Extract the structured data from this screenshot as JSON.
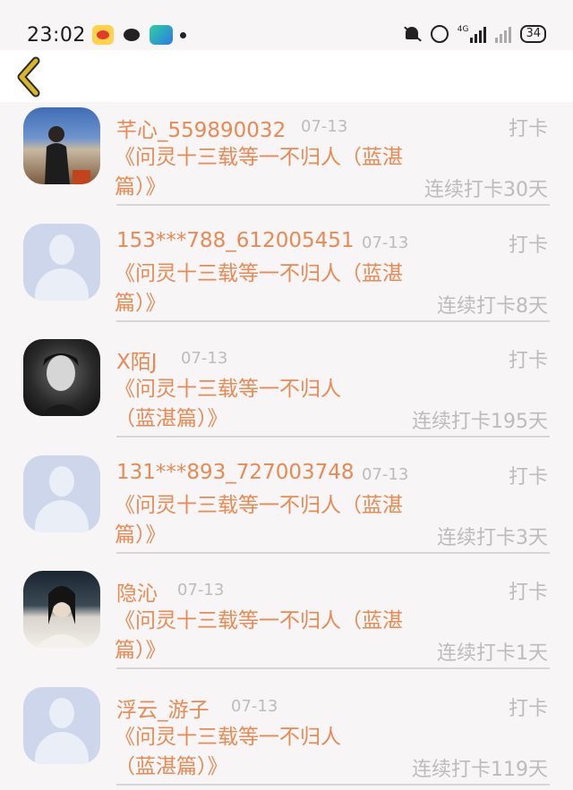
{
  "status_bar": {
    "time": "23:02",
    "network": "4G",
    "battery": "34",
    "icons": [
      "weibo-icon",
      "wechat-icon",
      "video-app-icon",
      "notification-dot",
      "mute-icon",
      "alarm-icon",
      "signal-icon",
      "signal-icon-2",
      "battery-icon"
    ]
  },
  "nav": {
    "back_icon": "chevron-left-icon",
    "back_color": "#d9b72a"
  },
  "colors": {
    "accent": "#e98a54",
    "muted": "#bcbcbc"
  },
  "checkins": [
    {
      "name": "芊心_559890032",
      "date": "07-13",
      "status": "打卡",
      "book": "《问灵十三载等一不归人（蓝湛篇）》",
      "streak": "连续打卡30天",
      "avatar": "photo1"
    },
    {
      "name": "153***788_612005451",
      "date": "07-13",
      "status": "打卡",
      "book": "《问灵十三载等一不归人（蓝湛篇）》",
      "streak": "连续打卡8天",
      "avatar": "default"
    },
    {
      "name": "X陌J",
      "date": "07-13",
      "status": "打卡",
      "book": "《问灵十三载等一不归人（蓝湛篇）》",
      "streak": "连续打卡195天",
      "avatar": "photo2"
    },
    {
      "name": "131***893_727003748",
      "date": "07-13",
      "status": "打卡",
      "book": "《问灵十三载等一不归人（蓝湛篇）》",
      "streak": "连续打卡3天",
      "avatar": "default"
    },
    {
      "name": "隐沁",
      "date": "07-13",
      "status": "打卡",
      "book": "《问灵十三载等一不归人（蓝湛篇）》",
      "streak": "连续打卡1天",
      "avatar": "photo3"
    },
    {
      "name": "浮云_游子",
      "date": "07-13",
      "status": "打卡",
      "book": "《问灵十三载等一不归人（蓝湛篇）》",
      "streak": "连续打卡119天",
      "avatar": "default"
    }
  ]
}
